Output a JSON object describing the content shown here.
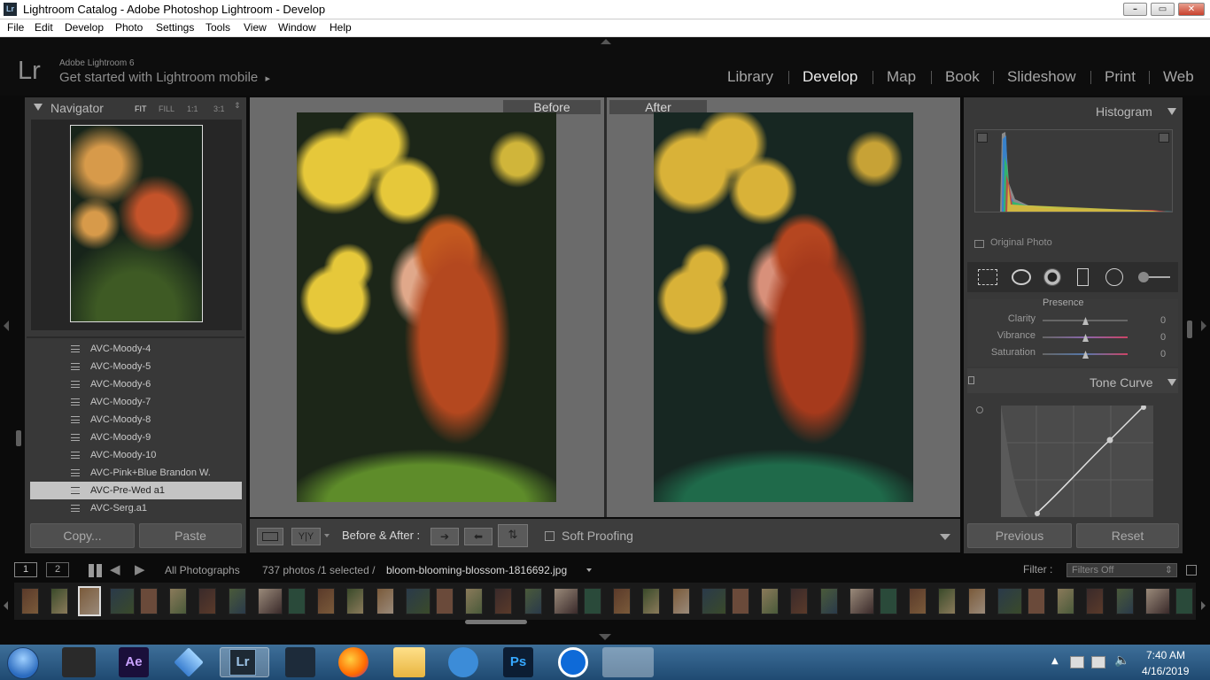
{
  "window": {
    "title": "Lightroom Catalog - Adobe Photoshop Lightroom - Develop",
    "icon": "Lr",
    "controls": [
      "minimize-icon",
      "maximize-icon",
      "close-icon"
    ]
  },
  "menu": [
    "File",
    "Edit",
    "Develop",
    "Photo",
    "Settings",
    "Tools",
    "View",
    "Window",
    "Help"
  ],
  "identity": {
    "mark": "Lr",
    "product": "Adobe Lightroom 6",
    "tagline": "Get started with Lightroom mobile",
    "arrow": "▸"
  },
  "modules": [
    "Library",
    "Develop",
    "Map",
    "Book",
    "Slideshow",
    "Print",
    "Web"
  ],
  "active_module": "Develop",
  "navigator": {
    "title": "Navigator",
    "zoom": [
      "FIT",
      "FILL",
      "1:1",
      "3:1"
    ],
    "zoom_selected": "FIT"
  },
  "presets": [
    "AVC-Moody-4",
    "AVC-Moody-5",
    "AVC-Moody-6",
    "AVC-Moody-7",
    "AVC-Moody-8",
    "AVC-Moody-9",
    "AVC-Moody-10",
    "AVC-Pink+Blue Brandon W.",
    "AVC-Pre-Wed a1",
    "AVC-Serg.a1"
  ],
  "selected_preset": "AVC-Pre-Wed a1",
  "left_buttons": {
    "copy": "Copy...",
    "paste": "Paste"
  },
  "compare": {
    "before": "Before",
    "after": "After"
  },
  "toolbar": {
    "before_after_label": "Before & After :",
    "yy": "Y|Y",
    "soft_proofing": "Soft Proofing"
  },
  "histogram": {
    "title": "Histogram",
    "original_photo": "Original Photo"
  },
  "presence": {
    "title": "Presence",
    "sliders": [
      {
        "label": "Clarity",
        "value": "0"
      },
      {
        "label": "Vibrance",
        "value": "0"
      },
      {
        "label": "Saturation",
        "value": "0"
      }
    ]
  },
  "tone_curve": {
    "title": "Tone Curve"
  },
  "right_buttons": {
    "previous": "Previous",
    "reset": "Reset"
  },
  "filmstrip": {
    "pages": [
      "1",
      "2"
    ],
    "source": "All Photographs",
    "count": "737 photos /1 selected /",
    "filename": "bloom-blooming-blossom-1816692.jpg",
    "filter_label": "Filter :",
    "filter_value": "Filters Off",
    "thumb_count": 40,
    "selected_thumb": 2
  },
  "taskbar": {
    "time": "7:40 AM",
    "date": "4/16/2019",
    "apps": [
      "windows-start-icon",
      "movie-maker-icon",
      "after-effects-icon",
      "app-icon",
      "lightroom-icon",
      "filmora-icon",
      "firefox-icon",
      "file-explorer-icon",
      "screen-recorder-icon",
      "photoshop-icon",
      "teamviewer-icon",
      "paint-icon"
    ],
    "app_labels": {
      "ae": "Ae",
      "lr": "Lr",
      "ps": "Ps"
    }
  },
  "colors": {
    "bg": "#0b0b0b",
    "panel": "#383838",
    "center": "#6b6b6b",
    "accent": "#cfcfcf",
    "selected_preset": "#c4c4c4"
  }
}
